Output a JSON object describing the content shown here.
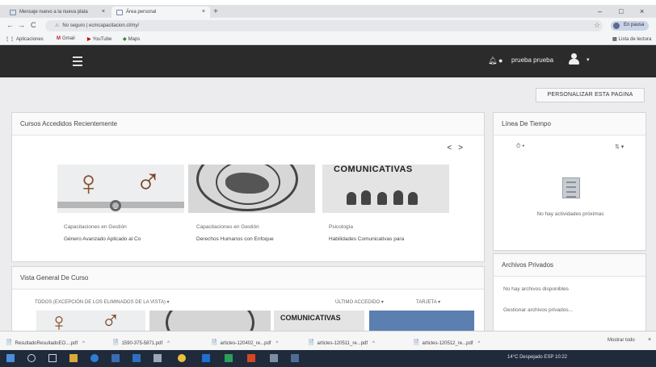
{
  "browser": {
    "tabs": [
      {
        "label": "Mensaje nuevo a la nueva plata",
        "close": "×"
      },
      {
        "label": "Área personal",
        "close": "×"
      }
    ],
    "new_tab": "+",
    "window_controls": {
      "minimize": "–",
      "maximize": "□",
      "close": "×"
    },
    "nav": {
      "back": "←",
      "forward": "→",
      "reload": "C"
    },
    "address": {
      "security": "No seguro",
      "url": "ecmcapacitacion.cl/my/"
    },
    "star": "☆",
    "profile_label": "En pausa",
    "bookmarks": [
      {
        "label": "Aplicaciones"
      },
      {
        "label": "Gmail"
      },
      {
        "label": "YouTube"
      },
      {
        "label": "Maps"
      }
    ],
    "reading_list": "Lista de lectura"
  },
  "header": {
    "username": "prueba prueba",
    "bell_icon": "bell-icon",
    "chat_icon": "chat-icon",
    "caret": "▾"
  },
  "main": {
    "personalize_button": "PERSONALIZAR ESTA PAGINA",
    "recent": {
      "title": "Cursos Accedidos Recientemente",
      "nav_prev": "<",
      "nav_next": ">",
      "courses": [
        {
          "line1": "Capacitaciones en Gestión",
          "line2": "Género Avanzado Aplicado al Co"
        },
        {
          "line1": "Capacitaciones en Gestión",
          "line2": "Derechos Humanos con Enfoque"
        },
        {
          "line1": "Psicología",
          "line2": "Habilidades Comunicativas para"
        }
      ],
      "course3_image_text": "COMUNICATIVAS"
    },
    "timeline": {
      "title": "Línea De Tiempo",
      "clock_control": "⏱ ▾",
      "sort_control": "⇅ ▾",
      "empty": "No hay actividades próximas"
    },
    "private_files": {
      "title": "Archivos Privados",
      "empty": "No hay archivos disponibles",
      "manage": "Gestionar archivos privados..."
    },
    "overview": {
      "title": "Vista General De Curso",
      "filter": "TODOS (EXCEPCIÓN DE LOS ELIMINADOS DE LA VISTA) ▾",
      "sort": "ÚLTIMO ACCEDIDO ▾",
      "view": "TARJETA ▾",
      "image_text": "COMUNICATIVAS"
    }
  },
  "downloads": {
    "items": [
      {
        "label": "ResultadoResultadoEO....pdf"
      },
      {
        "label": "1590-375-5871.pdf"
      },
      {
        "label": "articles-120402_re...pdf"
      },
      {
        "label": "articles-120511_re...pdf"
      },
      {
        "label": "articles-120512_re...pdf"
      }
    ],
    "show_all": "Mostrar todo",
    "close": "×"
  },
  "taskbar": {
    "tray_text": "14°C Despejado   ESP   10:22"
  }
}
